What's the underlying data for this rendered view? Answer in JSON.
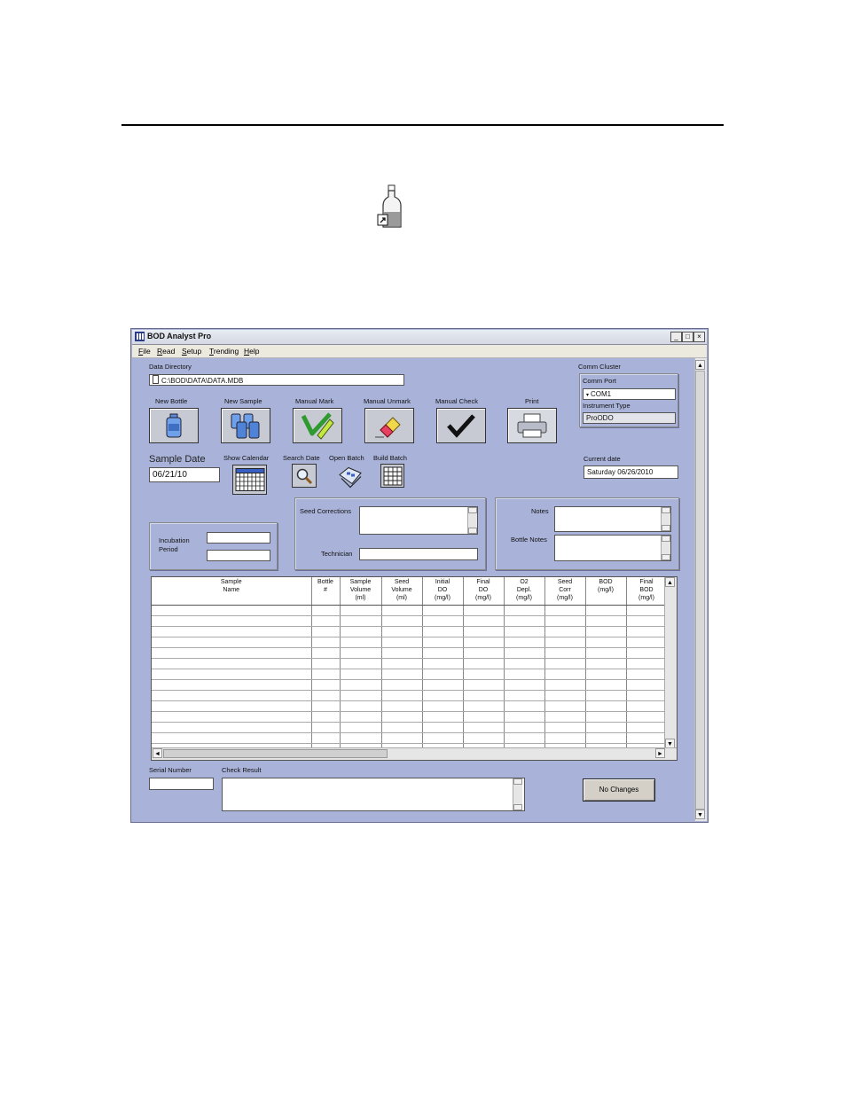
{
  "window": {
    "title": "BOD Analyst Pro",
    "controls": {
      "minimize": "_",
      "maximize": "□",
      "close": "×"
    }
  },
  "menu": [
    "File",
    "Read",
    "Setup",
    "Trending",
    "Help"
  ],
  "data_directory": {
    "label": "Data Directory",
    "value": "C:\\BOD\\DATA\\DATA.MDB"
  },
  "comm_cluster": {
    "label": "Comm Cluster",
    "comm_port_label": "Comm Port",
    "comm_port_value": "COM1",
    "instrument_type_label": "Instrument Type",
    "instrument_type_value": "ProODO"
  },
  "toolbar": [
    {
      "label": "New Bottle",
      "icon": "bottle-icon"
    },
    {
      "label": "New Sample",
      "icon": "sample-bottles-icon"
    },
    {
      "label": "Manual Mark",
      "icon": "marker-icon"
    },
    {
      "label": "Manual Unmark",
      "icon": "eraser-icon"
    },
    {
      "label": "Manual Check",
      "icon": "checkmark-icon"
    },
    {
      "label": "Print",
      "icon": "printer-icon"
    }
  ],
  "sample_date": {
    "label": "Sample Date",
    "value": "06/21/10"
  },
  "date_tools": {
    "show_calendar": "Show Calendar",
    "search_date": "Search Date",
    "open_batch": "Open Batch",
    "build_batch": "Build Batch"
  },
  "current_date": {
    "label": "Current date",
    "value": "Saturday 06/26/2010"
  },
  "incubation": {
    "label_line1": "Incubation",
    "label_line2": "Period",
    "value1": "",
    "value2": ""
  },
  "seed": {
    "corrections_label": "Seed Corrections",
    "technician_label": "Technician",
    "technician_value": ""
  },
  "notes": {
    "notes_label": "Notes",
    "bottle_notes_label": "Bottle Notes"
  },
  "grid": {
    "columns": [
      "Sample\nName",
      "Bottle\n#",
      "Sample\nVolume\n(ml)",
      "Seed\nVolume\n(ml)",
      "Initial\nDO\n(mg/l)",
      "Final\nDO\n(mg/l)",
      "O2\nDepl.\n(mg/l)",
      "Seed\nCorr\n(mg/l)",
      "BOD\n(mg/l)",
      "Final\nBOD\n(mg/l)"
    ]
  },
  "serial_number": {
    "label": "Serial Number",
    "value": ""
  },
  "check_result": {
    "label": "Check Result",
    "value": ""
  },
  "status_button": "No Changes",
  "scroll_arrows": {
    "up": "▲",
    "down": "▼",
    "left": "◄",
    "right": "►"
  }
}
